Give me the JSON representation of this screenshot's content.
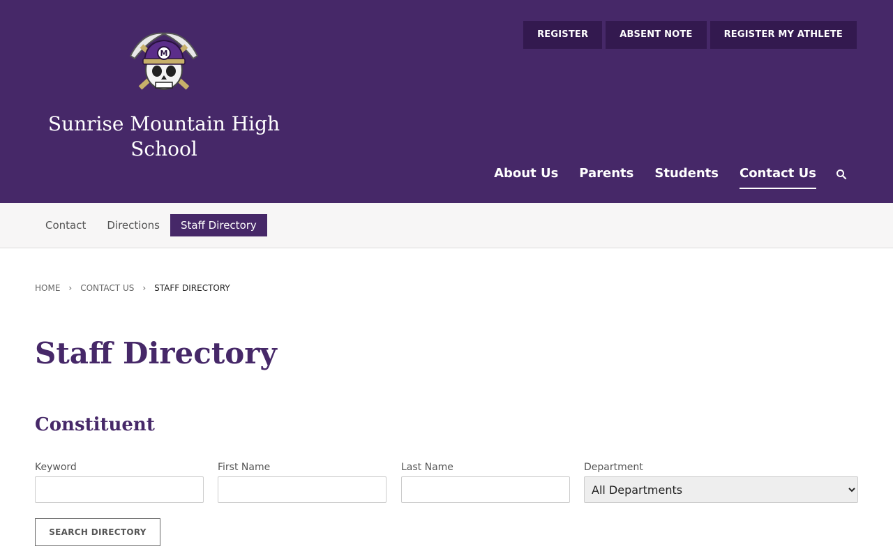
{
  "header": {
    "school_name": "Sunrise Mountain High School",
    "logo_letter": "M",
    "utility_nav": [
      "REGISTER",
      "ABSENT NOTE",
      "REGISTER MY ATHLETE"
    ],
    "main_nav": [
      {
        "label": "About Us",
        "active": false
      },
      {
        "label": "Parents",
        "active": false
      },
      {
        "label": "Students",
        "active": false
      },
      {
        "label": "Contact Us",
        "active": true
      }
    ],
    "search_icon": "search-icon"
  },
  "subnav": [
    {
      "label": "Contact",
      "active": false
    },
    {
      "label": "Directions",
      "active": false
    },
    {
      "label": "Staff Directory",
      "active": true
    }
  ],
  "breadcrumb": [
    "HOME",
    "CONTACT US",
    "STAFF DIRECTORY"
  ],
  "page_title": "Staff Directory",
  "section_title": "Constituent",
  "form": {
    "keyword_label": "Keyword",
    "keyword_value": "",
    "first_name_label": "First Name",
    "first_name_value": "",
    "last_name_label": "Last Name",
    "last_name_value": "",
    "department_label": "Department",
    "department_selected": "All Departments",
    "search_button": "SEARCH DIRECTORY"
  },
  "colors": {
    "brand_purple": "#462868",
    "utility_button": "#33194f",
    "logo_gold": "#c7b06a"
  }
}
